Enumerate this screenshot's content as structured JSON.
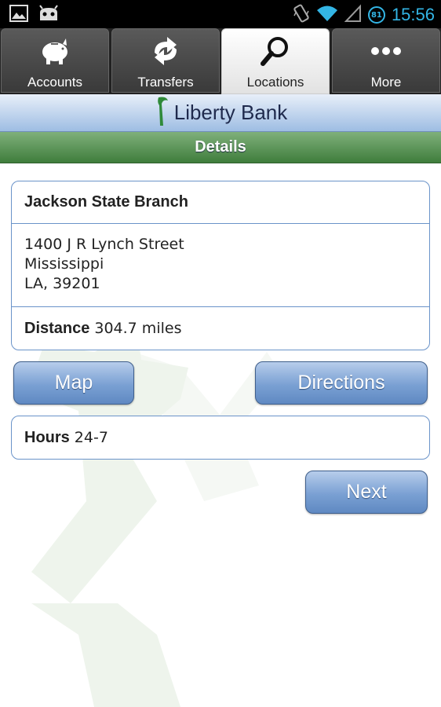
{
  "status_bar": {
    "time": "15:56",
    "battery_level": "81",
    "icons": [
      "gallery-icon",
      "android-debug-icon",
      "vibrate-icon",
      "wifi-icon",
      "signal-icon",
      "battery-icon"
    ]
  },
  "tabs": [
    {
      "label": "Accounts",
      "icon": "piggy-bank-icon",
      "active": false
    },
    {
      "label": "Transfers",
      "icon": "transfer-arrows-icon",
      "active": false
    },
    {
      "label": "Locations",
      "icon": "magnifier-icon",
      "active": true
    },
    {
      "label": "More",
      "icon": "more-dots-icon",
      "active": false
    }
  ],
  "brand": {
    "name": "Liberty Bank",
    "logo_icon": "liberty-torch-icon"
  },
  "header": {
    "title": "Details"
  },
  "branch": {
    "name": "Jackson State Branch",
    "address_line1": "1400 J R Lynch Street",
    "address_line2": "Mississippi",
    "address_line3": "LA, 39201",
    "distance_label": "Distance",
    "distance_value": "304.7 miles"
  },
  "buttons": {
    "map": "Map",
    "directions": "Directions",
    "next": "Next"
  },
  "hours": {
    "label": "Hours",
    "value": "24-7"
  },
  "colors": {
    "accent_blue": "#6a93c9",
    "header_green": "#3f7d3c",
    "status_blue": "#33b5e5",
    "tab_dark": "#3a3a3a"
  }
}
